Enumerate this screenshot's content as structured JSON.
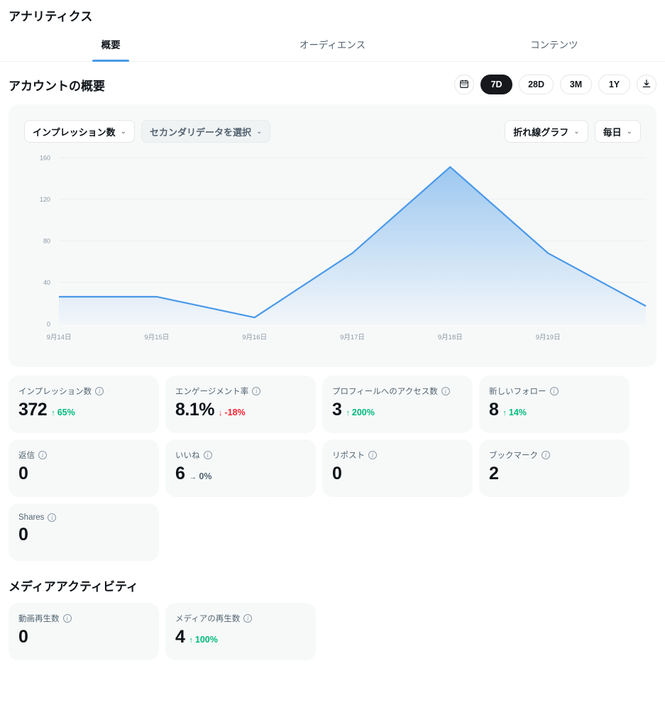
{
  "header": {
    "title": "アナリティクス"
  },
  "tabs": [
    {
      "label": "概要",
      "active": true
    },
    {
      "label": "オーディエンス",
      "active": false
    },
    {
      "label": "コンテンツ",
      "active": false
    }
  ],
  "section": {
    "title": "アカウントの概要",
    "calendar_icon": "calendar-icon",
    "download_icon": "download-icon",
    "ranges": [
      {
        "label": "7D",
        "active": true
      },
      {
        "label": "28D",
        "active": false
      },
      {
        "label": "3M",
        "active": false
      },
      {
        "label": "1Y",
        "active": false
      }
    ]
  },
  "chart_controls": {
    "primary_metric": "インプレッション数",
    "secondary_metric": "セカンダリデータを選択",
    "chart_type": "折れ線グラフ",
    "granularity": "毎日",
    "chevron": "⌄"
  },
  "chart_data": {
    "type": "area",
    "title": "インプレッション数",
    "xlabel": "",
    "ylabel": "",
    "categories": [
      "9月14日",
      "9月15日",
      "9月16日",
      "9月17日",
      "9月18日",
      "9月19日",
      ""
    ],
    "tick_labels": [
      "9月14日",
      "9月15日",
      "9月16日",
      "9月17日",
      "9月18日",
      "9月19日"
    ],
    "values": [
      26,
      26,
      6,
      68,
      151,
      68,
      17
    ],
    "ylim": [
      0,
      160
    ],
    "yticks": [
      0,
      40,
      80,
      120,
      160
    ],
    "grid": true,
    "legend": "none",
    "line_color": "#4a99e9",
    "fill_top": "#9dc8f0",
    "fill_bottom": "#f2f6fa"
  },
  "metrics": [
    {
      "label": "インプレッション数",
      "value": "372",
      "delta": "65%",
      "dir": "up"
    },
    {
      "label": "エンゲージメント率",
      "value": "8.1%",
      "delta": "-18%",
      "dir": "down"
    },
    {
      "label": "プロフィールへのアクセス数",
      "value": "3",
      "delta": "200%",
      "dir": "up"
    },
    {
      "label": "新しいフォロー",
      "value": "8",
      "delta": "14%",
      "dir": "up"
    },
    {
      "label": "返信",
      "value": "0",
      "delta": "",
      "dir": ""
    },
    {
      "label": "いいね",
      "value": "6",
      "delta": "0%",
      "dir": "flat"
    },
    {
      "label": "リポスト",
      "value": "0",
      "delta": "",
      "dir": ""
    },
    {
      "label": "ブックマーク",
      "value": "2",
      "delta": "",
      "dir": ""
    },
    {
      "label": "Shares",
      "value": "0",
      "delta": "",
      "dir": ""
    }
  ],
  "media_section": {
    "title": "メディアアクティビティ",
    "metrics": [
      {
        "label": "動画再生数",
        "value": "0",
        "delta": "",
        "dir": ""
      },
      {
        "label": "メディアの再生数",
        "value": "4",
        "delta": "100%",
        "dir": "up"
      }
    ]
  },
  "arrows": {
    "up": "↑",
    "down": "↓",
    "flat": "→"
  }
}
